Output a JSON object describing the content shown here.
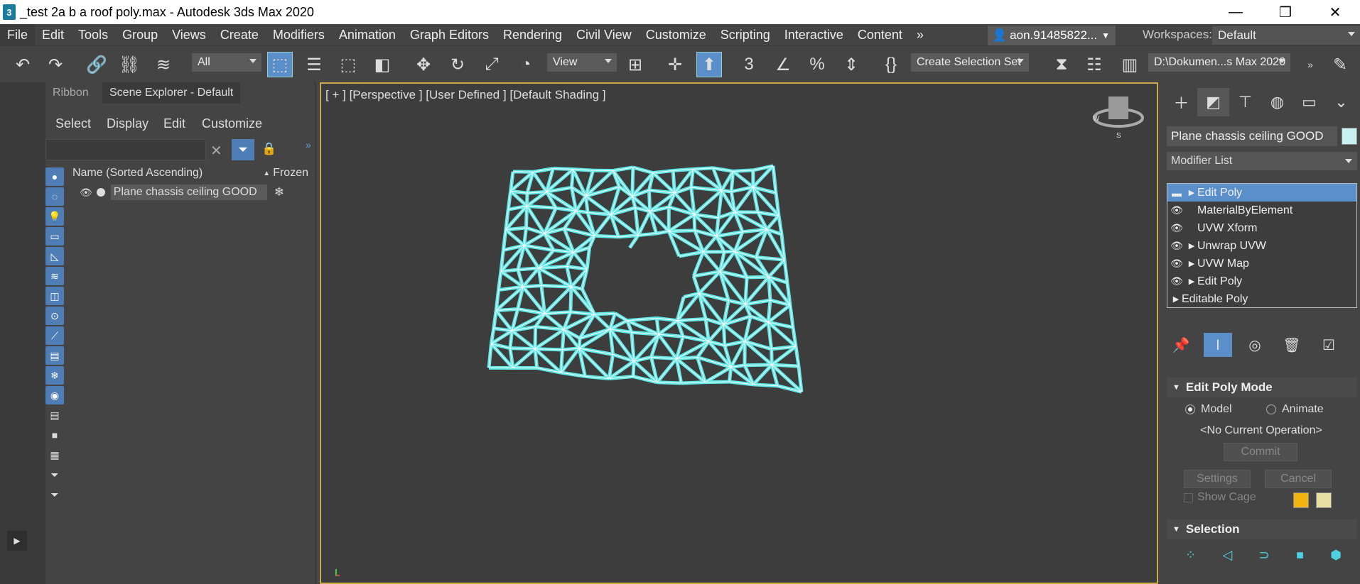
{
  "window": {
    "title": "_test 2a b a roof poly.max - Autodesk 3ds Max 2020",
    "app_icon": "3"
  },
  "menu": [
    "File",
    "Edit",
    "Tools",
    "Group",
    "Views",
    "Create",
    "Modifiers",
    "Animation",
    "Graph Editors",
    "Rendering",
    "Civil View",
    "Customize",
    "Scripting",
    "Interactive",
    "Content"
  ],
  "menu_overflow": "»",
  "user": {
    "name": "aon.91485822..."
  },
  "workspaces": {
    "label": "Workspaces:",
    "value": "Default"
  },
  "toolbar": {
    "selection_filter": "All",
    "ref_coord": "View",
    "snap_3d": "3",
    "selection_set": "Create Selection Set",
    "project_path": "D:\\Dokumen...s Max 2020"
  },
  "scene_explorer": {
    "tabs": [
      "Ribbon",
      "Scene Explorer - Default"
    ],
    "menu": [
      "Select",
      "Display",
      "Edit",
      "Customize"
    ],
    "column_name": "Name (Sorted Ascending)",
    "column_frozen": "Frozen",
    "sort_marker": "▲",
    "rows": [
      {
        "name": "Plane chassis ceiling GOOD"
      }
    ]
  },
  "viewport": {
    "labels": [
      "[ + ]",
      "[Perspective ]",
      "[User Defined ]",
      "[Default Shading ]"
    ],
    "mesh_color": "#5fe8e8"
  },
  "command_panel": {
    "object_name": "Plane chassis ceiling GOOD",
    "object_color": "#c8f2f2",
    "modifier_list": "Modifier List",
    "stack": [
      {
        "label": "Edit Poly",
        "selected": true,
        "expandable": true
      },
      {
        "label": "MaterialByElement",
        "expandable": false
      },
      {
        "label": "UVW Xform",
        "expandable": false
      },
      {
        "label": "Unwrap UVW",
        "expandable": true
      },
      {
        "label": "UVW Map",
        "expandable": true
      },
      {
        "label": "Edit Poly",
        "expandable": true
      },
      {
        "label": "Editable Poly",
        "expandable": true,
        "base": true
      }
    ],
    "edit_poly_mode": {
      "title": "Edit Poly Mode",
      "model": "Model",
      "animate": "Animate",
      "operation": "<No Current Operation>",
      "commit": "Commit",
      "settings": "Settings",
      "cancel": "Cancel",
      "show_cage": "Show Cage",
      "cage_color_1": "#f2b410",
      "cage_color_2": "#e8e0a0"
    },
    "selection": {
      "title": "Selection"
    }
  }
}
